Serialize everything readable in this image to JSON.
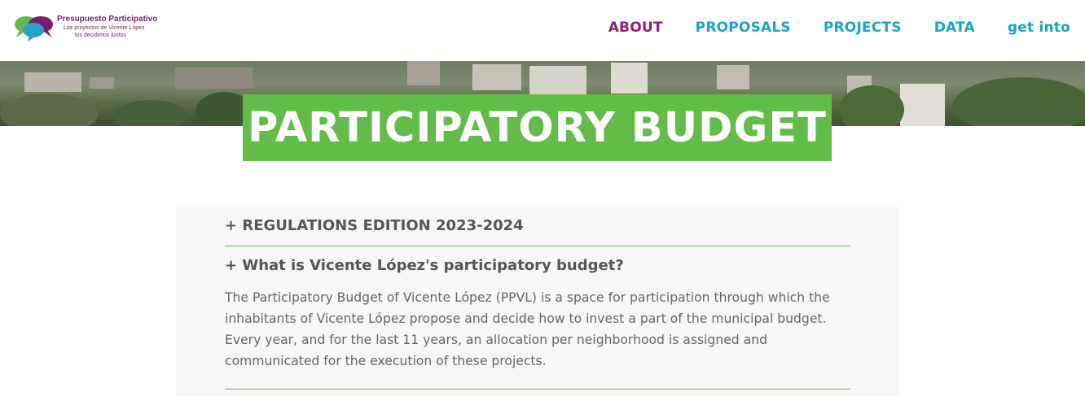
{
  "logo": {
    "title": "Presupuesto Participativo",
    "subtitle_line1": "Los proyectos de Vicente López",
    "subtitle_line2": "los decidimos juntos"
  },
  "nav": {
    "items": [
      {
        "label": "ABOUT",
        "active": true
      },
      {
        "label": "PROPOSALS",
        "active": false
      },
      {
        "label": "PROJECTS",
        "active": false
      },
      {
        "label": "DATA",
        "active": false
      },
      {
        "label": "get into",
        "active": false
      }
    ]
  },
  "hero": {
    "title": "PARTICIPATORY BUDGET"
  },
  "faq": {
    "items": [
      {
        "question": "+ REGULATIONS EDITION 2023-2024",
        "answer": ""
      },
      {
        "question": "+ What is Vicente López's participatory budget?",
        "answer": "The Participatory Budget of Vicente López (PPVL) is a space for participation through which the inhabitants of Vicente López propose and decide how to invest a part of the municipal budget. Every year, and for the last 11 years, an allocation per neighborhood is assigned and communicated for the execution of these projects."
      }
    ]
  },
  "colors": {
    "accent_green": "#63bb4a",
    "nav_blue": "#1aa5c8",
    "nav_active_purple": "#8f1e77"
  }
}
